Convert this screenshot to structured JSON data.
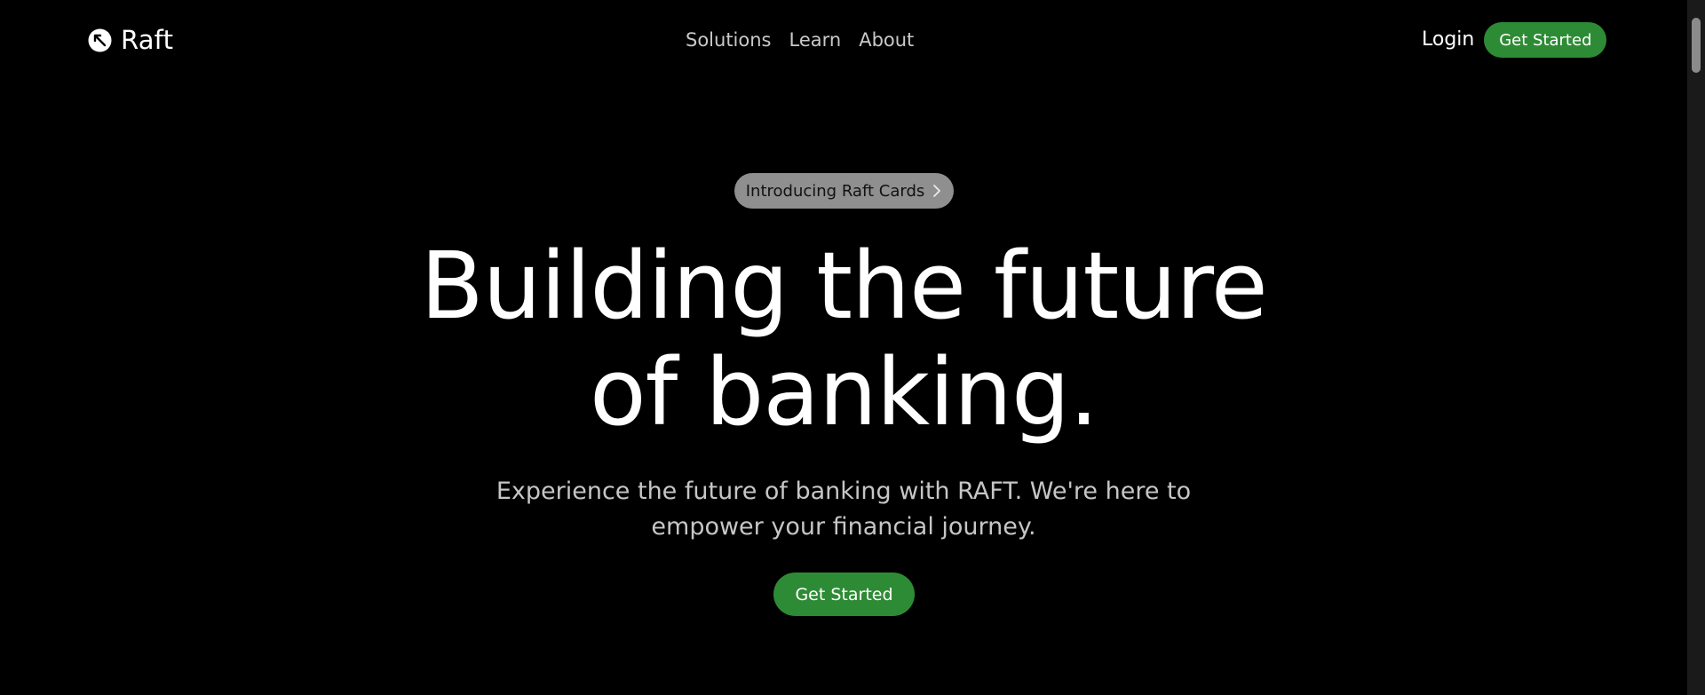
{
  "header": {
    "brand_name": "Raft",
    "nav": [
      "Solutions",
      "Learn",
      "About"
    ],
    "login_label": "Login",
    "cta_label": "Get Started"
  },
  "hero": {
    "badge_label": "Introducing Raft Cards",
    "title_line1": "Building the future",
    "title_line2": "of banking.",
    "subtitle": "Experience the future of banking with RAFT. We're here to empower your financial journey.",
    "cta_label": "Get Started"
  },
  "colors": {
    "background": "#000000",
    "accent_green": "#2e8b35",
    "badge_gray": "#8f8f8f",
    "muted_text": "#c6c6c6"
  },
  "icons": {
    "logo": "raft-logo-icon",
    "badge": "chevron-right-icon"
  }
}
